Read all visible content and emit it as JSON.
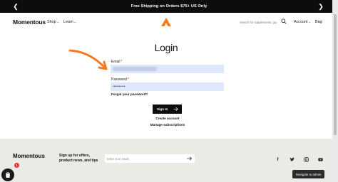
{
  "announcement": {
    "text": "Free Shipping on Orders $75+ US Only"
  },
  "header": {
    "logo": "Momentous",
    "nav": {
      "shop": "Shop",
      "learn": "Learn",
      "account": "Account",
      "bag": "Bag"
    },
    "search_placeholder": "Search for supplements, goals..."
  },
  "login": {
    "title": "Login",
    "email_label": "Email",
    "required_mark": "*",
    "password_label": "Password",
    "password_value": "••••••••••",
    "forgot_link": "Forgot your password?",
    "signin_button": "Sign In",
    "create_account": "Create account",
    "manage_subscriptions": "Manage subscriptions"
  },
  "footer": {
    "logo": "Momentous",
    "signup_text": "Sign up for offers, product news, and tips",
    "email_placeholder": "Enter your email",
    "navigate_admin": "Navigate to admin",
    "shop_badge_count": "1"
  },
  "colors": {
    "accent": "#f57a1f",
    "dark": "#0d0d0d",
    "footer_bg": "#eceae4",
    "field_bg": "#dfe7fb"
  }
}
